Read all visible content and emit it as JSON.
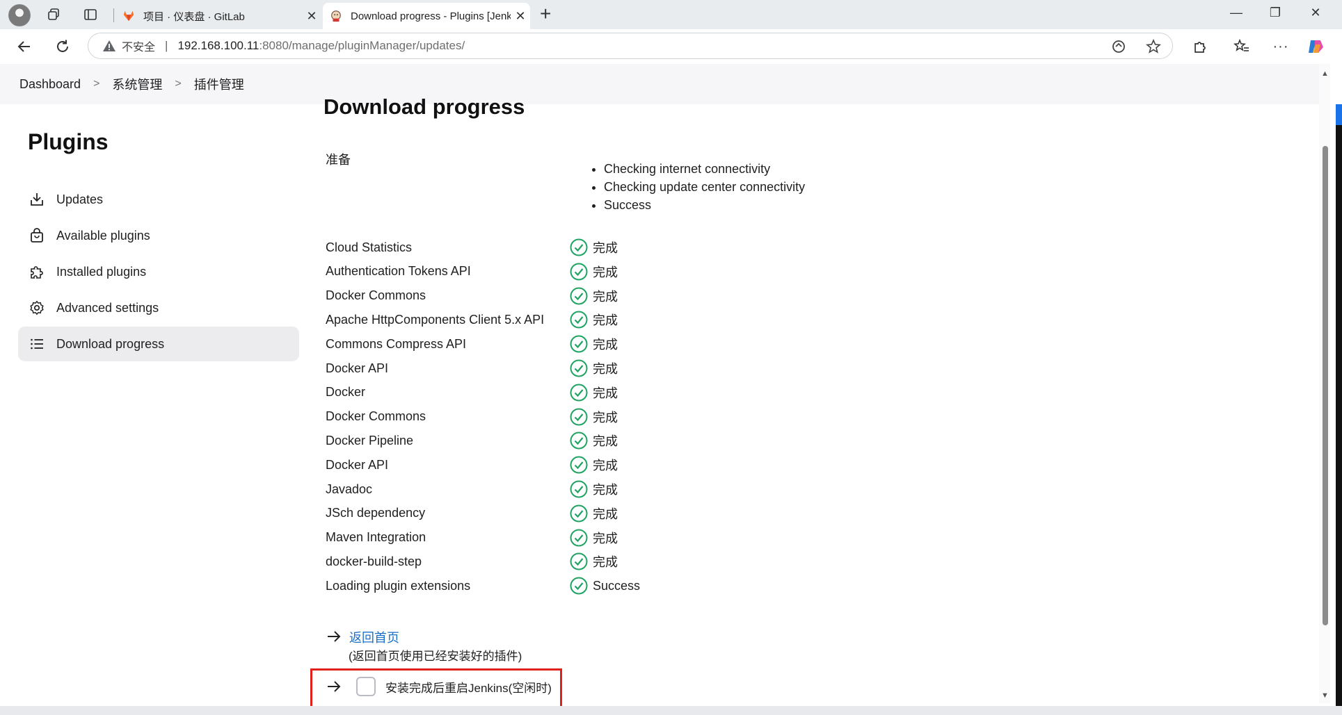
{
  "browser": {
    "tabs": [
      {
        "title": "项目 · 仪表盘 · GitLab",
        "active": false
      },
      {
        "title": "Download progress - Plugins [Jenkins]",
        "active": true
      }
    ],
    "address": {
      "insecure_label": "不安全",
      "host": "192.168.100.11",
      "path": ":8080/manage/pluginManager/updates/"
    }
  },
  "breadcrumb": [
    "Dashboard",
    "系统管理",
    "插件管理"
  ],
  "sidebar": {
    "title": "Plugins",
    "items": [
      {
        "label": "Updates",
        "icon": "download-icon",
        "selected": false
      },
      {
        "label": "Available plugins",
        "icon": "shopping-bag-icon",
        "selected": false
      },
      {
        "label": "Installed plugins",
        "icon": "puzzle-icon",
        "selected": false
      },
      {
        "label": "Advanced settings",
        "icon": "gear-icon",
        "selected": false
      },
      {
        "label": "Download progress",
        "icon": "list-icon",
        "selected": true
      }
    ]
  },
  "main": {
    "title": "Download progress",
    "preparation": {
      "label": "准备",
      "steps": [
        "Checking internet connectivity",
        "Checking update center connectivity",
        "Success"
      ]
    },
    "plugins": [
      {
        "name": "Cloud Statistics",
        "status": "完成"
      },
      {
        "name": "Authentication Tokens API",
        "status": "完成"
      },
      {
        "name": "Docker Commons",
        "status": "完成"
      },
      {
        "name": "Apache HttpComponents Client 5.x API",
        "status": "完成"
      },
      {
        "name": "Commons Compress API",
        "status": "完成"
      },
      {
        "name": "Docker API",
        "status": "完成"
      },
      {
        "name": "Docker",
        "status": "完成"
      },
      {
        "name": "Docker Commons",
        "status": "完成"
      },
      {
        "name": "Docker Pipeline",
        "status": "完成"
      },
      {
        "name": "Docker API",
        "status": "完成"
      },
      {
        "name": "Javadoc",
        "status": "完成"
      },
      {
        "name": "JSch dependency",
        "status": "完成"
      },
      {
        "name": "Maven Integration",
        "status": "完成"
      },
      {
        "name": "docker-build-step",
        "status": "完成"
      },
      {
        "name": "Loading plugin extensions",
        "status": "Success"
      }
    ],
    "home_link": "返回首页",
    "home_desc": "(返回首页使用已经安装好的插件)",
    "restart_label": "安装完成后重启Jenkins(空闲时)",
    "restart_checked": false
  },
  "colors": {
    "success": "#1ea362",
    "link": "#1a6fc9",
    "highlight_box": "#e0201b"
  }
}
